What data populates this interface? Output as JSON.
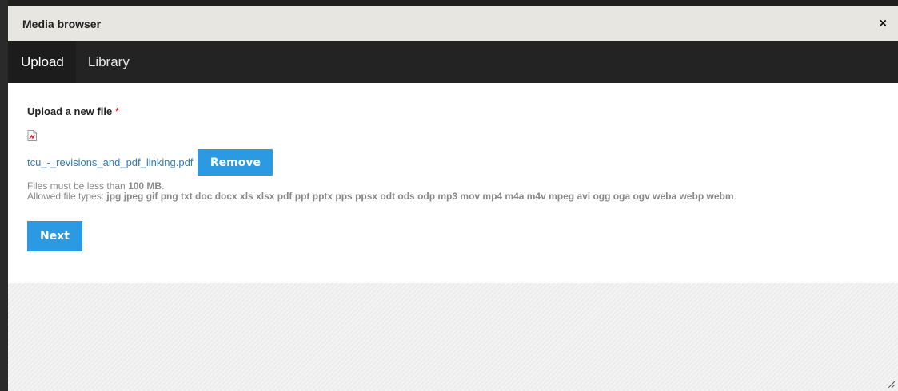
{
  "dialog": {
    "title": "Media browser",
    "close_glyph": "×"
  },
  "tabs": [
    {
      "label": "Upload",
      "active": true
    },
    {
      "label": "Library",
      "active": false
    }
  ],
  "upload": {
    "label": "Upload a new file",
    "required_marker": "*",
    "file_icon": "pdf-file-icon",
    "file_name": "tcu_-_revisions_and_pdf_linking.pdf",
    "remove_label": "Remove",
    "size_prefix": "Files must be less than ",
    "size_value": "100 MB",
    "size_suffix": ".",
    "types_prefix": "Allowed file types: ",
    "types_value": "jpg jpeg gif png txt doc docx xls xlsx pdf ppt pptx pps ppsx odt ods odp mp3 mov mp4 m4a m4v mpeg avi ogg oga ogv weba webp webm",
    "types_suffix": ".",
    "next_label": "Next"
  },
  "colors": {
    "accent": "#2b9ae2",
    "tabbar": "#232323",
    "titlebar": "#e8e6e1",
    "link": "#2a7fc1",
    "required": "#e00000"
  }
}
